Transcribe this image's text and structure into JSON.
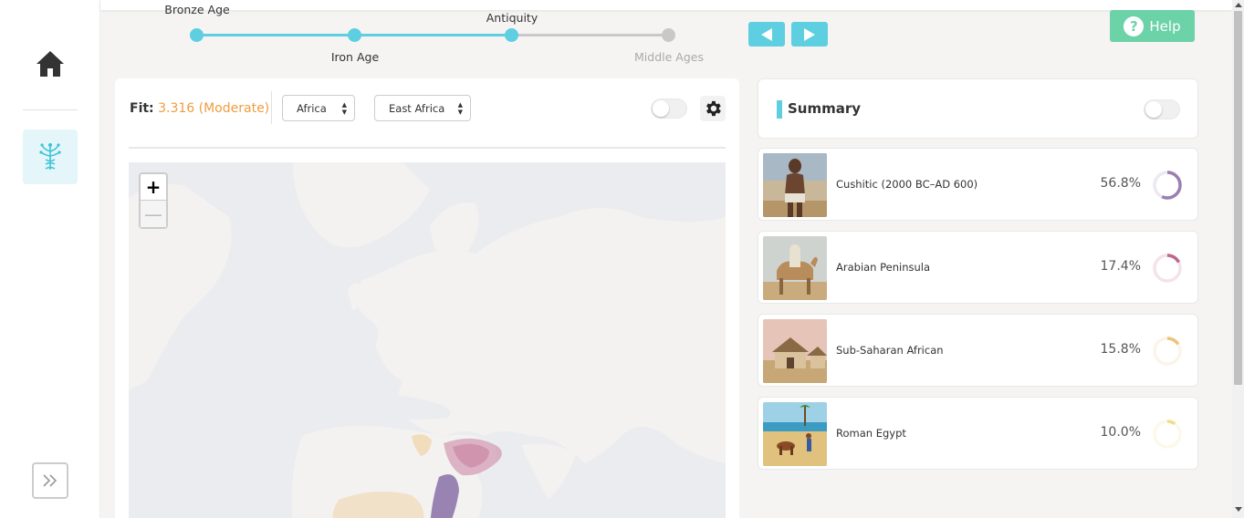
{
  "timeline": {
    "eras": [
      {
        "label": "Bronze Age"
      },
      {
        "label": "Iron Age"
      },
      {
        "label": "Antiquity"
      },
      {
        "label": "Middle Ages"
      }
    ],
    "active_color": "#5dcfe0",
    "inactive_color": "#c8c8c8"
  },
  "help": {
    "label": "Help"
  },
  "map_panel": {
    "fit_label": "Fit:",
    "fit_value": "3.316 (Moderate)",
    "region_select": "Africa",
    "subregion_select": "East Africa",
    "zoom_in": "+",
    "zoom_out": "—"
  },
  "summary": {
    "title": "Summary",
    "items": [
      {
        "name": "Cushitic (2000 BC–AD 600)",
        "percent": "56.8%",
        "fraction": 0.568,
        "color": "#9b7fb0"
      },
      {
        "name": "Arabian Peninsula",
        "percent": "17.4%",
        "fraction": 0.174,
        "color": "#c0668f"
      },
      {
        "name": "Sub-Saharan African",
        "percent": "15.8%",
        "fraction": 0.158,
        "color": "#efc27d"
      },
      {
        "name": "Roman Egypt",
        "percent": "10.0%",
        "fraction": 0.1,
        "color": "#f0dc8a"
      }
    ]
  },
  "icons": {
    "home": "home-icon",
    "dna": "dna-tree-icon",
    "expand": "double-chevron-right-icon",
    "settings": "gear-icon",
    "prev": "triangle-left-icon",
    "next": "triangle-right-icon",
    "help": "question-circle-icon"
  }
}
